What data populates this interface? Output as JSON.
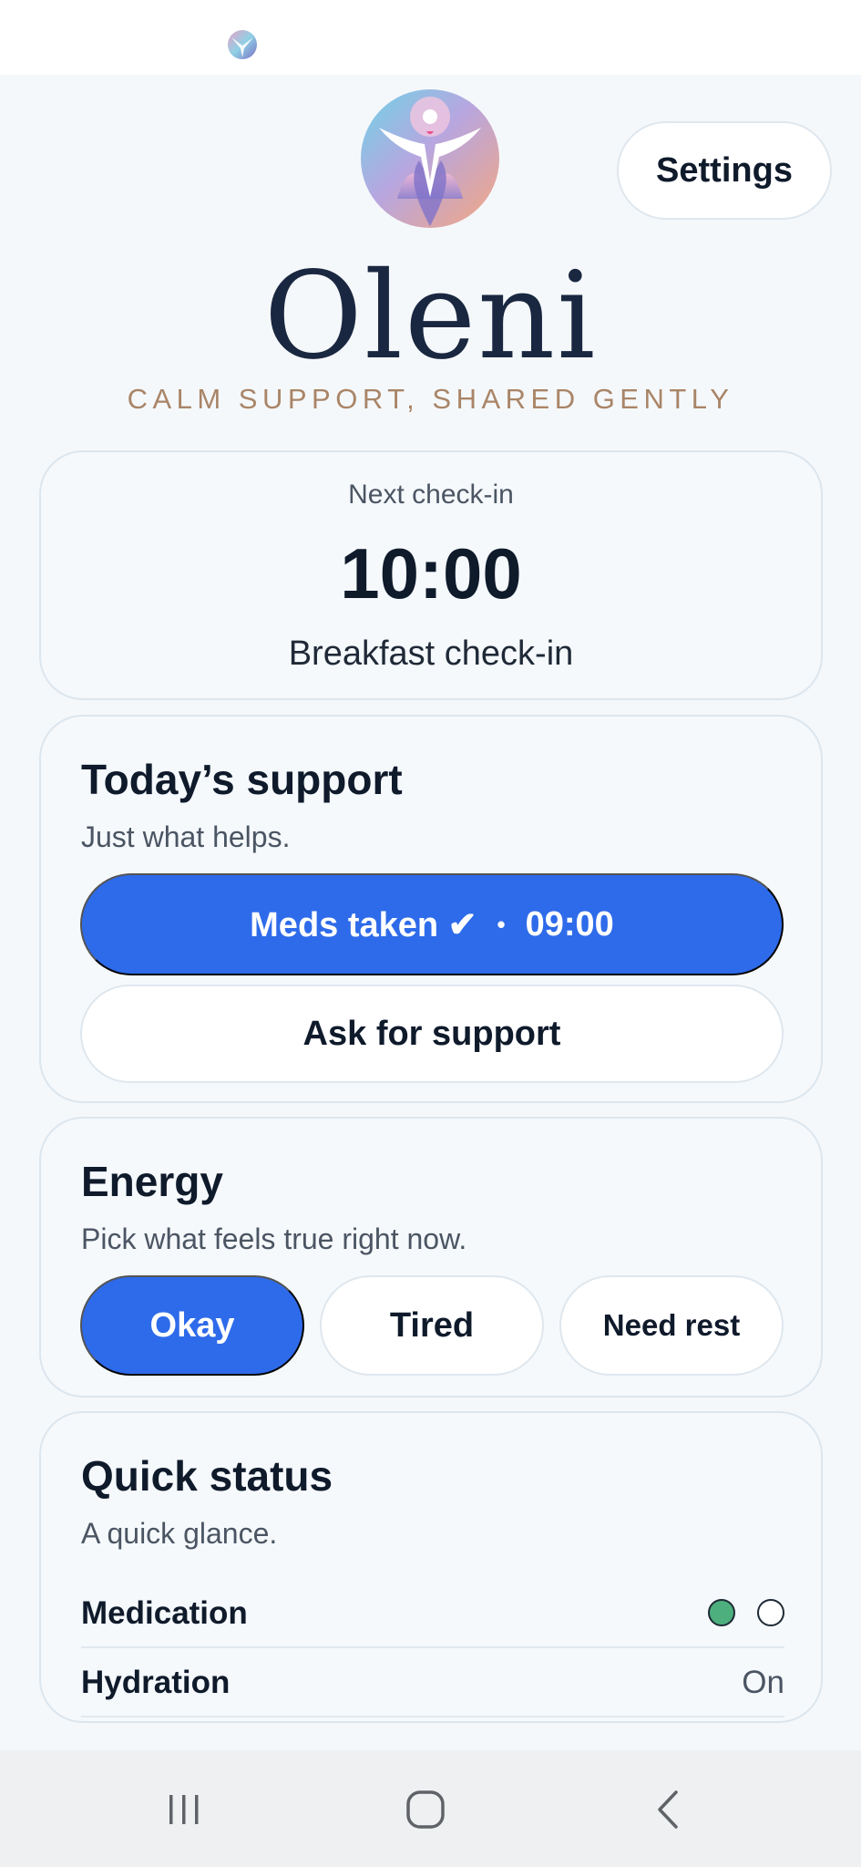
{
  "app": {
    "title": "Oleni",
    "tagline": "CALM SUPPORT, SHARED GENTLY",
    "settings_label": "Settings",
    "logo_icon": "oleni-figure-logo"
  },
  "checkin": {
    "label": "Next check-in",
    "time": "10:00",
    "description": "Breakfast check-in"
  },
  "support": {
    "title": "Today’s support",
    "subtitle": "Just what helps.",
    "meds_label": "Meds taken ✔",
    "meds_separator": "•",
    "meds_time": "09:00",
    "ask_label": "Ask for support"
  },
  "energy": {
    "title": "Energy",
    "subtitle": "Pick what feels true right now.",
    "options": [
      {
        "label": "Okay",
        "selected": true
      },
      {
        "label": "Tired",
        "selected": false
      },
      {
        "label": "Need rest",
        "selected": false
      }
    ]
  },
  "quick_status": {
    "title": "Quick status",
    "subtitle": "A quick glance.",
    "rows": [
      {
        "label": "Medication",
        "value": "",
        "indicators": [
          "filled",
          "empty"
        ]
      },
      {
        "label": "Hydration",
        "value": "On"
      }
    ]
  },
  "nav": {
    "recents_icon": "recents-icon",
    "home_icon": "home-icon",
    "back_icon": "back-icon"
  },
  "colors": {
    "primary": "#2e6bea",
    "tagline": "#a98568",
    "status_green": "#4caf7d",
    "background": "#f5f8fb"
  }
}
